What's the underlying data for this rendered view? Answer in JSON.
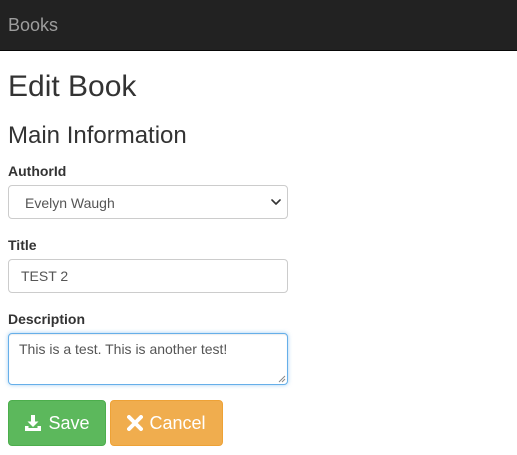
{
  "navbar": {
    "brand": "Books"
  },
  "page": {
    "title": "Edit Book",
    "section_title": "Main Information"
  },
  "form": {
    "author": {
      "label": "AuthorId",
      "selected": "Evelyn Waugh"
    },
    "title": {
      "label": "Title",
      "value": "TEST 2"
    },
    "description": {
      "label": "Description",
      "value": "This is a test. This is another test!"
    }
  },
  "buttons": {
    "save": {
      "label": "Save",
      "icon": "download-icon",
      "color": "#5cb85c"
    },
    "cancel": {
      "label": "Cancel",
      "icon": "close-icon",
      "color": "#f0ad4e"
    }
  }
}
